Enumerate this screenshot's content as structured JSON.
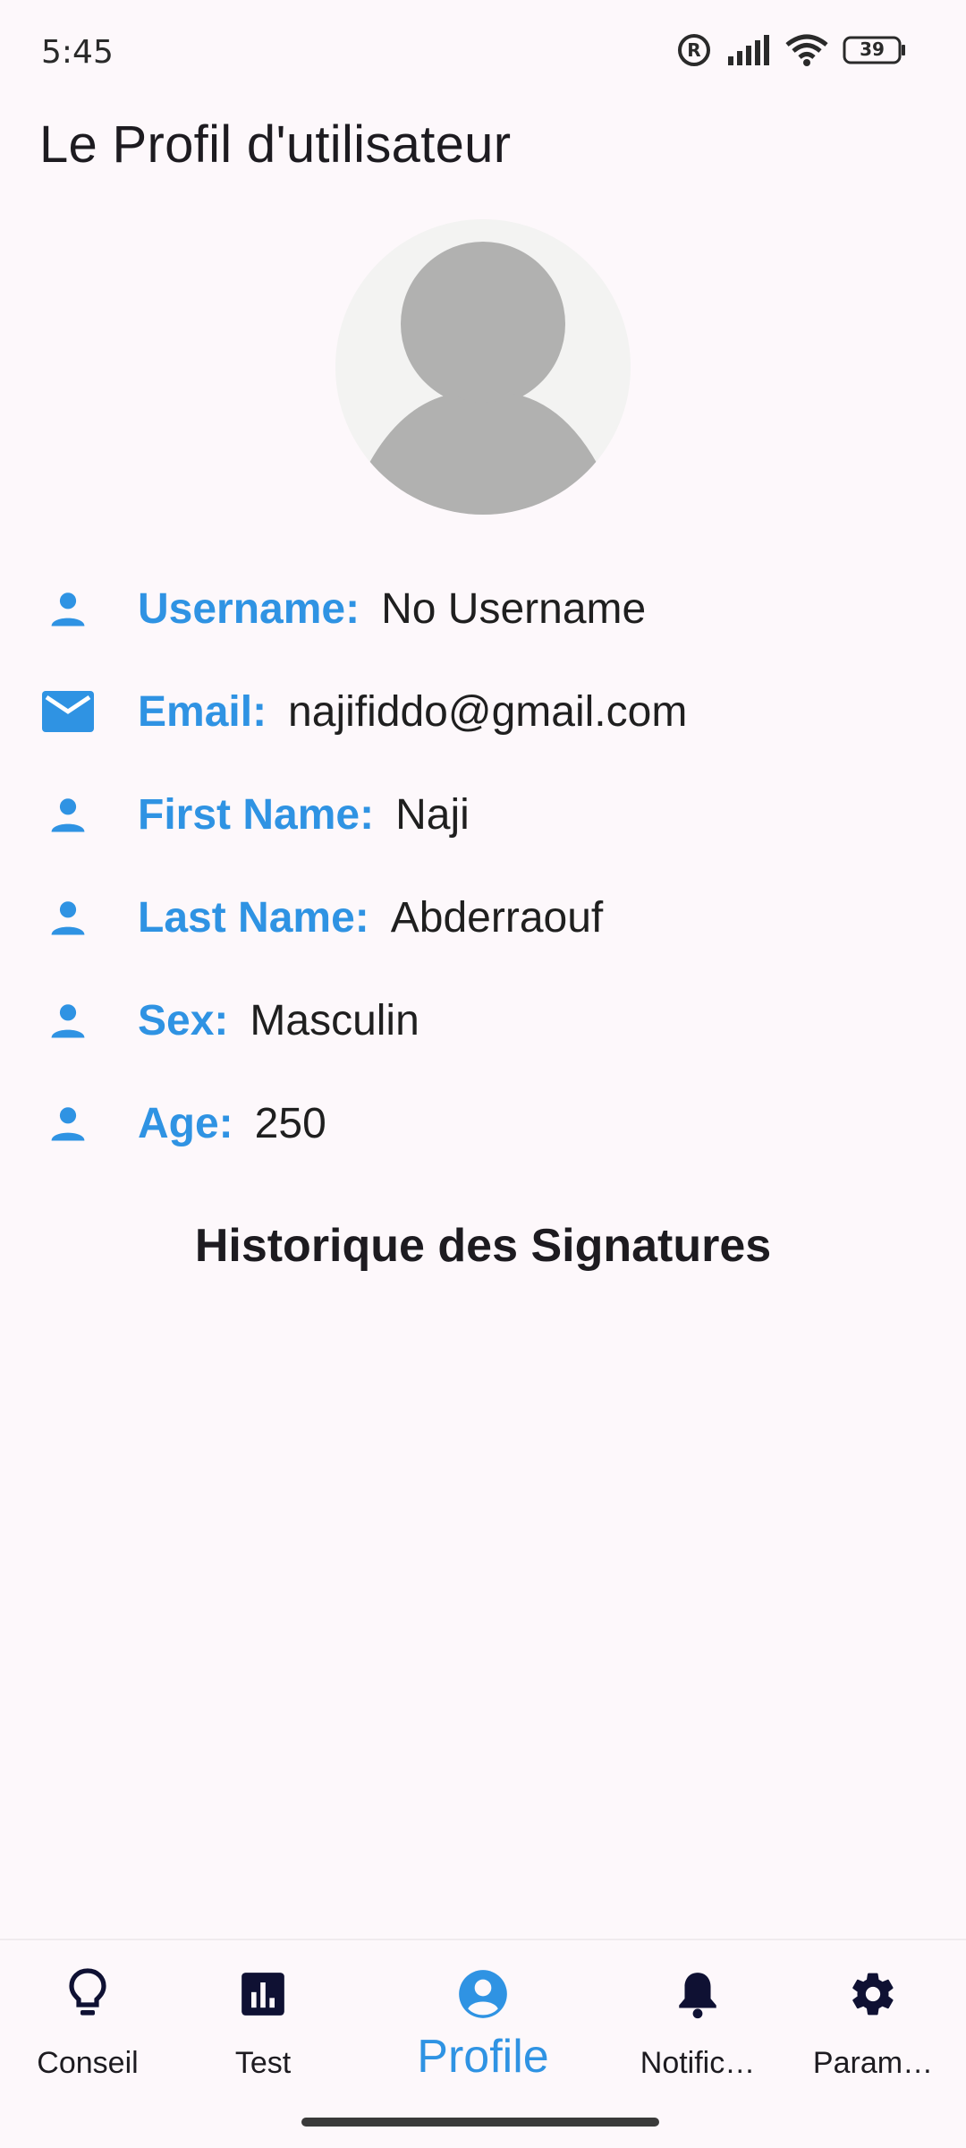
{
  "status_bar": {
    "time": "5:45",
    "battery_level": "39",
    "icons": [
      "registered-icon",
      "signal-icon",
      "wifi-icon",
      "battery-icon"
    ]
  },
  "page": {
    "title": "Le Profil d'utilisateur"
  },
  "profile": {
    "avatar": "person-placeholder-avatar",
    "fields": [
      {
        "icon": "person-icon",
        "label": "Username:",
        "value": "No Username"
      },
      {
        "icon": "email-icon",
        "label": "Email:",
        "value": "najifiddo@gmail.com"
      },
      {
        "icon": "person-icon",
        "label": "First Name:",
        "value": "Naji"
      },
      {
        "icon": "person-icon",
        "label": "Last Name:",
        "value": "Abderraouf"
      },
      {
        "icon": "person-icon",
        "label": "Sex:",
        "value": "Masculin"
      },
      {
        "icon": "person-icon",
        "label": "Age:",
        "value": "250"
      }
    ]
  },
  "history": {
    "title": "Historique des Signatures"
  },
  "bottom_nav": {
    "items": [
      {
        "icon": "lightbulb-icon",
        "label": "Conseil",
        "active": false
      },
      {
        "icon": "bar-chart-icon",
        "label": "Test",
        "active": false
      },
      {
        "icon": "account-circle-icon",
        "label": "Profile",
        "active": true
      },
      {
        "icon": "bell-icon",
        "label": "Notific…",
        "active": false
      },
      {
        "icon": "gear-icon",
        "label": "Param…",
        "active": false
      }
    ]
  },
  "colors": {
    "accent": "#2f93e3",
    "background": "#fdf8fb",
    "nav_icon": "#0f1133",
    "avatar_gray": "#b1b1b0"
  }
}
